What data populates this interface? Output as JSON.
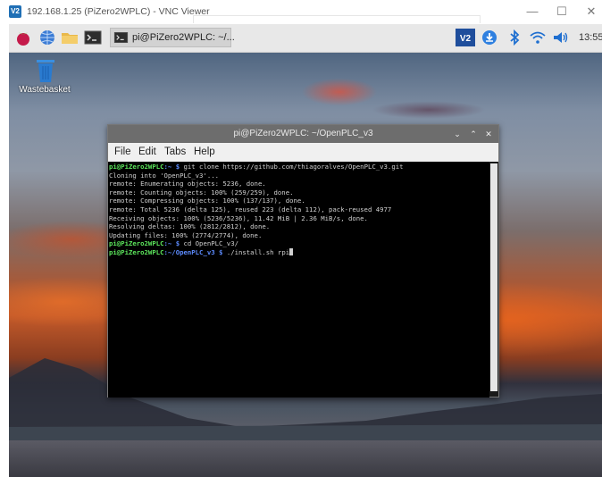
{
  "viewer": {
    "title": "192.168.1.25 (PiZero2WPLC) - VNC Viewer",
    "logo": "V2",
    "controls": [
      "—",
      "☐",
      "✕"
    ]
  },
  "taskbar": {
    "task_label": "pi@PiZero2WPLC: ~/...",
    "clock": "13:55",
    "icons": [
      "raspberry-menu-icon",
      "web-browser-icon",
      "file-manager-icon",
      "terminal-icon",
      "vnc-server-icon",
      "update-icon",
      "bluetooth-icon",
      "wifi-icon",
      "volume-icon"
    ]
  },
  "desktop": {
    "wastebasket_label": "Wastebasket"
  },
  "terminal": {
    "title": "pi@PiZero2WPLC: ~/OpenPLC_v3",
    "buttons": [
      "⌄",
      "⌃",
      "✕"
    ],
    "menu": [
      "File",
      "Edit",
      "Tabs",
      "Help"
    ],
    "lines": [
      {
        "user": "pi@PiZero2WPLC",
        "path": ":~ $",
        "cmd": " git clone https://github.com/thiagoralves/OpenPLC_v3.git"
      },
      {
        "text": "Cloning into 'OpenPLC_v3'..."
      },
      {
        "text": "remote: Enumerating objects: 5236, done."
      },
      {
        "text": "remote: Counting objects: 100% (259/259), done."
      },
      {
        "text": "remote: Compressing objects: 100% (137/137), done."
      },
      {
        "text": "remote: Total 5236 (delta 125), reused 223 (delta 112), pack-reused 4977"
      },
      {
        "text": "Receiving objects: 100% (5236/5236), 11.42 MiB | 2.36 MiB/s, done."
      },
      {
        "text": "Resolving deltas: 100% (2812/2812), done."
      },
      {
        "text": "Updating files: 100% (2774/2774), done."
      },
      {
        "user": "pi@PiZero2WPLC",
        "path": ":~ $",
        "cmd": " cd OpenPLC_v3/"
      },
      {
        "user": "pi@PiZero2WPLC",
        "path": ":~/OpenPLC_v3 $",
        "cmd": " ./install.sh rpi",
        "cursor": true
      }
    ]
  },
  "colors": {
    "prompt_user": "#5ce65c",
    "prompt_path": "#5d8cff",
    "terminal_bg": "#000000",
    "taskbar_bg": "#e8e8e8"
  }
}
